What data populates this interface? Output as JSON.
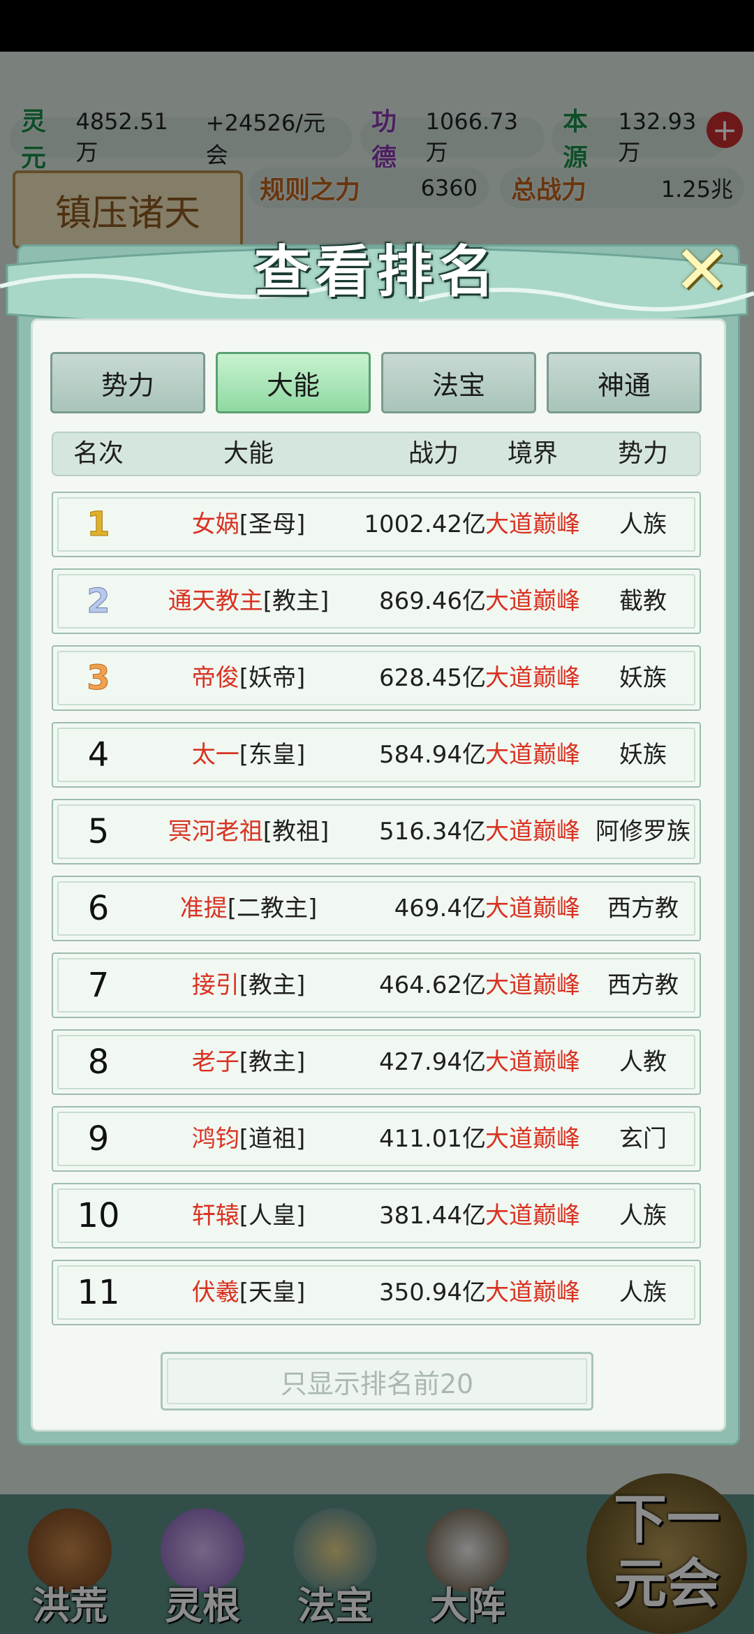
{
  "resources": {
    "lingyuan_label": "灵元",
    "lingyuan_value": "4852.51万",
    "lingyuan_rate": "+24526/元会",
    "gongde_label": "功德",
    "gongde_value": "1066.73万",
    "benyuan_label": "本源",
    "benyuan_value": "132.93万",
    "plus": "+",
    "guize_label": "规则之力",
    "guize_value": "6360",
    "zhanli_label": "总战力",
    "zhanli_value": "1.25兆"
  },
  "banner": {
    "title": "镇压诸天"
  },
  "modal": {
    "title": "查看排名",
    "close": "✕",
    "tabs": [
      {
        "label": "势力",
        "active": false
      },
      {
        "label": "大能",
        "active": true
      },
      {
        "label": "法宝",
        "active": false
      },
      {
        "label": "神通",
        "active": false
      }
    ],
    "columns": {
      "rank": "名次",
      "name": "大能",
      "power": "战力",
      "realm": "境界",
      "faction": "势力"
    },
    "rows": [
      {
        "rank": "1",
        "name": "女娲",
        "title": "[圣母]",
        "power": "1002.42亿",
        "realm": "大道巅峰",
        "faction": "人族"
      },
      {
        "rank": "2",
        "name": "通天教主",
        "title": "[教主]",
        "power": "869.46亿",
        "realm": "大道巅峰",
        "faction": "截教"
      },
      {
        "rank": "3",
        "name": "帝俊",
        "title": "[妖帝]",
        "power": "628.45亿",
        "realm": "大道巅峰",
        "faction": "妖族"
      },
      {
        "rank": "4",
        "name": "太一",
        "title": "[东皇]",
        "power": "584.94亿",
        "realm": "大道巅峰",
        "faction": "妖族"
      },
      {
        "rank": "5",
        "name": "冥河老祖",
        "title": "[教祖]",
        "power": "516.34亿",
        "realm": "大道巅峰",
        "faction": "阿修罗族"
      },
      {
        "rank": "6",
        "name": "准提",
        "title": "[二教主]",
        "power": "469.4亿",
        "realm": "大道巅峰",
        "faction": "西方教"
      },
      {
        "rank": "7",
        "name": "接引",
        "title": "[教主]",
        "power": "464.62亿",
        "realm": "大道巅峰",
        "faction": "西方教"
      },
      {
        "rank": "8",
        "name": "老子",
        "title": "[教主]",
        "power": "427.94亿",
        "realm": "大道巅峰",
        "faction": "人教"
      },
      {
        "rank": "9",
        "name": "鸿钧",
        "title": "[道祖]",
        "power": "411.01亿",
        "realm": "大道巅峰",
        "faction": "玄门"
      },
      {
        "rank": "10",
        "name": "轩辕",
        "title": "[人皇]",
        "power": "381.44亿",
        "realm": "大道巅峰",
        "faction": "人族"
      },
      {
        "rank": "11",
        "name": "伏羲",
        "title": "[天皇]",
        "power": "350.94亿",
        "realm": "大道巅峰",
        "faction": "人族"
      }
    ],
    "show_top_button": "只显示排名前20"
  },
  "nav": {
    "items": [
      {
        "label": "洪荒",
        "icon": "mountain-icon"
      },
      {
        "label": "灵根",
        "icon": "lotus-icon"
      },
      {
        "label": "法宝",
        "icon": "treasure-icon"
      },
      {
        "label": "大阵",
        "icon": "formation-icon"
      }
    ],
    "next_label": "下一元会"
  },
  "colors": {
    "accent_red": "#d93222",
    "tab_active": "#8fd9a2",
    "panel_bg": "#f4f8f3",
    "modal_frame": "#8fbdb0"
  }
}
